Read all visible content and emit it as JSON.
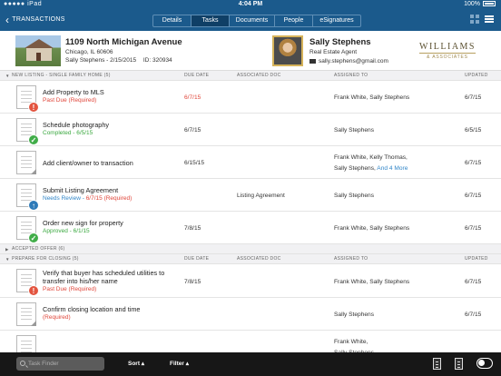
{
  "status_bar": {
    "time": "4:04 PM",
    "carrier": "iPad",
    "battery": "100%"
  },
  "nav": {
    "back_label": "TRANSACTIONS",
    "tabs": [
      {
        "label": "Details",
        "active": false
      },
      {
        "label": "Tasks",
        "active": true
      },
      {
        "label": "Documents",
        "active": false
      },
      {
        "label": "People",
        "active": false
      },
      {
        "label": "eSignatures",
        "active": false
      }
    ],
    "icons": [
      "grid-view-icon",
      "list-view-icon"
    ]
  },
  "property": {
    "address": "1109 North Michigan Avenue",
    "city": "Chicago, IL 60606",
    "owner_date": "Sally Stephens - 2/15/2015",
    "id": "ID: 320934"
  },
  "agent": {
    "name": "Sally Stephens",
    "role": "Real Estate Agent",
    "email": "sally.stephens@gmail.com"
  },
  "brand": {
    "logo_top": "WILLIAMS",
    "logo_bottom": "& ASSOCIATES"
  },
  "columns": {
    "due": "DUE DATE",
    "doc": "ASSOCIATED DOC",
    "assigned": "ASSIGNED TO",
    "updated": "UPDATED"
  },
  "sections": [
    {
      "title": "NEW LISTING - SINGLE FAMILY HOME (5)",
      "expanded": true,
      "show_columns": true,
      "tasks": [
        {
          "title": "Add Property to MLS",
          "sub": "Past Due (Required)",
          "sub_color": "red",
          "badge": "!",
          "badge_color": "red",
          "due": "6/7/15",
          "due_red": true,
          "doc": "",
          "assigned": "Frank White, Sally Stephens",
          "assigned_more": "",
          "updated": "6/7/15"
        },
        {
          "title": "Schedule photography",
          "sub": "Completed - 6/5/15",
          "sub_color": "green",
          "badge": "✓",
          "badge_color": "green",
          "due": "6/7/15",
          "due_red": false,
          "doc": "",
          "assigned": "Sally Stephens",
          "assigned_more": "",
          "updated": "6/5/15"
        },
        {
          "title": "Add client/owner to transaction",
          "sub": "",
          "sub_color": "",
          "badge": "",
          "badge_color": "",
          "due": "6/15/15",
          "due_red": false,
          "doc": "",
          "assigned": "Frank White, Kelly Thomas,",
          "assigned2": "Sally Stephens,",
          "assigned_more": "And 4 More",
          "updated": "6/7/15"
        },
        {
          "title": "Submit Listing Agreement",
          "sub": "Needs Review - ",
          "sub_date": "6/7/15",
          "sub_req": " (Required)",
          "sub_color": "blue",
          "badge": "↑",
          "badge_color": "blue",
          "due": "",
          "due_red": false,
          "doc": "Listing Agreement",
          "assigned": "Sally Stephens",
          "assigned_more": "",
          "updated": "6/7/15"
        },
        {
          "title": "Order new sign for property",
          "sub": "Approved - 6/1/15",
          "sub_color": "green",
          "badge": "✓",
          "badge_color": "green",
          "due": "7/8/15",
          "due_red": false,
          "doc": "",
          "assigned": "Frank White, Sally Stephens",
          "assigned_more": "",
          "updated": "6/7/15"
        }
      ]
    },
    {
      "title": "ACCEPTED OFFER (6)",
      "expanded": false,
      "show_columns": false,
      "tasks": []
    },
    {
      "title": "PREPARE FOR CLOSING (5)",
      "expanded": true,
      "show_columns": true,
      "tasks": [
        {
          "title": "Verify that buyer has scheduled utilities to",
          "title2": "transfer into his/her name",
          "sub": "Past Due (Required)",
          "sub_color": "red",
          "badge": "!",
          "badge_color": "red",
          "due": "7/8/15",
          "due_red": false,
          "doc": "",
          "assigned": "Frank White, Sally Stephens",
          "assigned_more": "",
          "updated": "6/7/15"
        },
        {
          "title": "Confirm closing location and time",
          "sub": "(Required)",
          "sub_color": "red",
          "badge": "",
          "badge_color": "",
          "due": "",
          "due_red": false,
          "doc": "",
          "assigned": "Sally Stephens",
          "assigned_more": "",
          "updated": "6/7/15"
        },
        {
          "title": "",
          "sub": "",
          "sub_color": "",
          "badge": "",
          "badge_color": "",
          "due": "",
          "due_red": false,
          "doc": "",
          "assigned": "Frank White,",
          "assigned2": "Sally Stephens,",
          "assigned_more": "",
          "updated": ""
        }
      ]
    }
  ],
  "toolbar": {
    "search_placeholder": "Task Finder",
    "sort_label": "Sort ▴",
    "filter_label": "Filter ▴"
  }
}
